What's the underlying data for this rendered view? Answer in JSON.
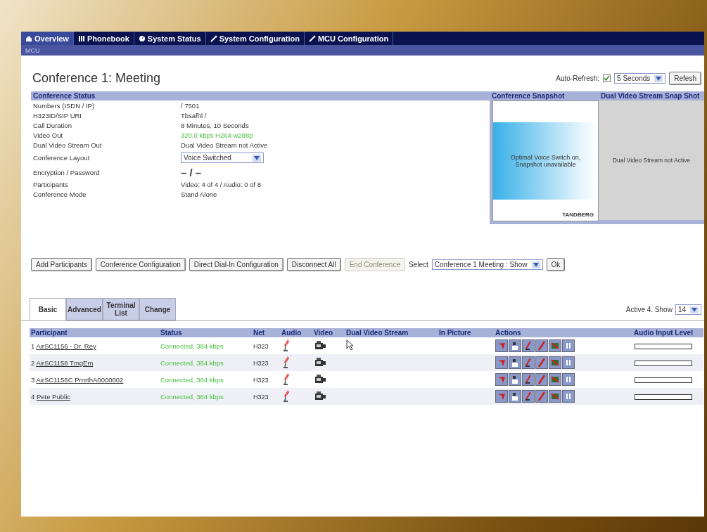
{
  "nav": {
    "tabs": [
      {
        "label": "Overview",
        "selected": true
      },
      {
        "label": "Phonebook",
        "selected": false
      },
      {
        "label": "System Status",
        "selected": false
      },
      {
        "label": "System Configuration",
        "selected": false
      },
      {
        "label": "MCU Configuration",
        "selected": false
      }
    ],
    "breadcrumb": "MCU"
  },
  "title": "Conference 1: Meeting",
  "refresh": {
    "label": "Auto-Refresh:",
    "checked": true,
    "interval": "5 Seconds",
    "button": "Refesh"
  },
  "status": {
    "heading": "Conference Status",
    "rows": [
      {
        "label": "Numbers (ISDN / IP)",
        "value": "/ 7501",
        "kind": "text"
      },
      {
        "label": "H323ID/SIP URI",
        "value": "Tbsafhl /",
        "kind": "text"
      },
      {
        "label": "Call Duration",
        "value": "8 Minutes, 10 Seconds",
        "kind": "text"
      },
      {
        "label": "Video Out",
        "value": "320.0 kbps H264 w288p",
        "kind": "good"
      },
      {
        "label": "Dual Video Stream Out",
        "value": "Dual Video Stream not Active",
        "kind": "text"
      },
      {
        "label": "Conference Layout",
        "value": "Voice Switched",
        "kind": "select"
      },
      {
        "label": "Encryption / Password",
        "value": "– / –",
        "kind": "big"
      },
      {
        "label": "Participants",
        "value": "Video: 4 of 4 / Audio: 0 of 8",
        "kind": "text"
      },
      {
        "label": "Conference Mode",
        "value": "Stand Alone",
        "kind": "text"
      }
    ]
  },
  "snapshots": [
    {
      "heading": "Conference Snapshot",
      "message": "Optimal Voice Switch on, Snapshot unavailable",
      "logo": "TANDBERG",
      "kind": "image"
    },
    {
      "heading": "Dual Video Stream Snap Shot",
      "message": "Dual Video Stream not Active",
      "kind": "grey"
    }
  ],
  "actions": [
    {
      "label": "Add Participants",
      "disabled": false
    },
    {
      "label": "Conference Configuration",
      "disabled": false
    },
    {
      "label": "Direct Dial-In Configuration",
      "disabled": false
    },
    {
      "label": "Disconnect All",
      "disabled": false
    },
    {
      "label": "End Conference",
      "disabled": true
    }
  ],
  "select": {
    "label": "Select",
    "value": "Conference 1 Meeting : Show",
    "button": "Ok"
  },
  "tabs": [
    {
      "label": "Basic",
      "selected": true
    },
    {
      "label": "Advanced",
      "selected": false
    },
    {
      "label": "Terminal List",
      "selected": false
    },
    {
      "label": "Change",
      "selected": false
    }
  ],
  "show": {
    "label": "Active 4. Show",
    "value": "14"
  },
  "table": {
    "columns": [
      "Participant",
      "Status",
      "Net",
      "Audio",
      "Video",
      "Dual Video Stream",
      "In Picture",
      "Actions",
      "Audio Input Level"
    ],
    "rows": [
      {
        "index": "1",
        "name": "AirSC1156 - Dr. Rey",
        "status": "Connected, 384 kbps",
        "net": "H323",
        "level": 0
      },
      {
        "index": "2",
        "name": "AirSC1158 TmgEm",
        "status": "Connected, 384 kbps",
        "net": "H323",
        "level": 0
      },
      {
        "index": "3",
        "name": "AirSC1156C PrnrthA0000002",
        "status": "Connected, 384 kbps",
        "net": "H323",
        "level": 0
      },
      {
        "index": "4",
        "name": "Pete Public",
        "status": "Connected, 384 kbps",
        "net": "H323",
        "level": 0
      }
    ]
  }
}
